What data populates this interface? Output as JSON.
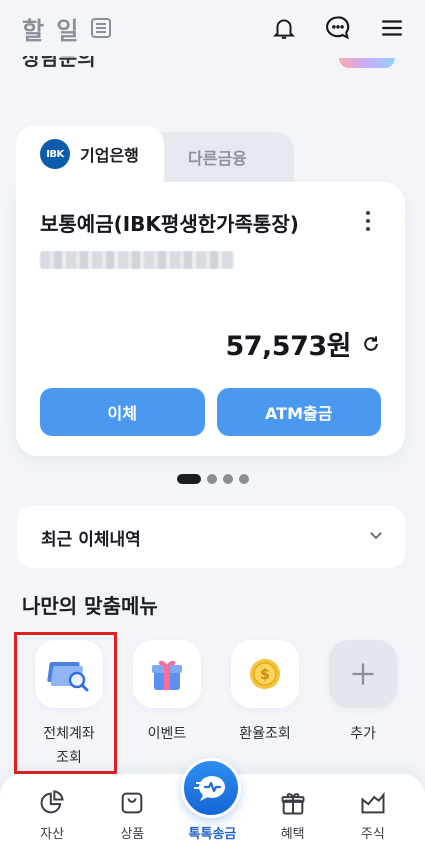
{
  "header": {
    "app_title": "할 일",
    "icons": [
      "list-icon",
      "bell-icon",
      "chat-icon",
      "menu-icon"
    ]
  },
  "scrolled_text": "상담문의",
  "account_card": {
    "tabs": [
      {
        "label": "기업은행",
        "logo": "IBK",
        "active": true
      },
      {
        "label": "다른금융",
        "active": false
      }
    ],
    "account_name": "보통예금(IBK평생한가족통장)",
    "balance": "57,573원",
    "buttons": {
      "transfer": "이체",
      "atm": "ATM출금"
    }
  },
  "pager": {
    "count": 4,
    "active_index": 0
  },
  "recent_transfers": {
    "label": "최근 이체내역"
  },
  "custom_menu": {
    "title": "나만의 맞춤메뉴",
    "items": [
      {
        "label": "전체계좌\n조회",
        "icon": "account-search-icon"
      },
      {
        "label": "이벤트",
        "icon": "gift-box-icon"
      },
      {
        "label": "환율조회",
        "icon": "coin-icon"
      },
      {
        "label": "추가",
        "icon": "plus-icon"
      }
    ]
  },
  "bottom_nav": [
    {
      "label": "자산",
      "icon": "pie-chart-icon"
    },
    {
      "label": "상품",
      "icon": "shopping-bag-icon"
    },
    {
      "label": "톡톡송금",
      "icon": "send-chat-icon"
    },
    {
      "label": "혜택",
      "icon": "gift-icon"
    },
    {
      "label": "주식",
      "icon": "stock-chart-icon"
    }
  ],
  "colors": {
    "primary": "#4a98f0",
    "highlight": "#e02020",
    "brand_blue": "#0b5cab"
  }
}
